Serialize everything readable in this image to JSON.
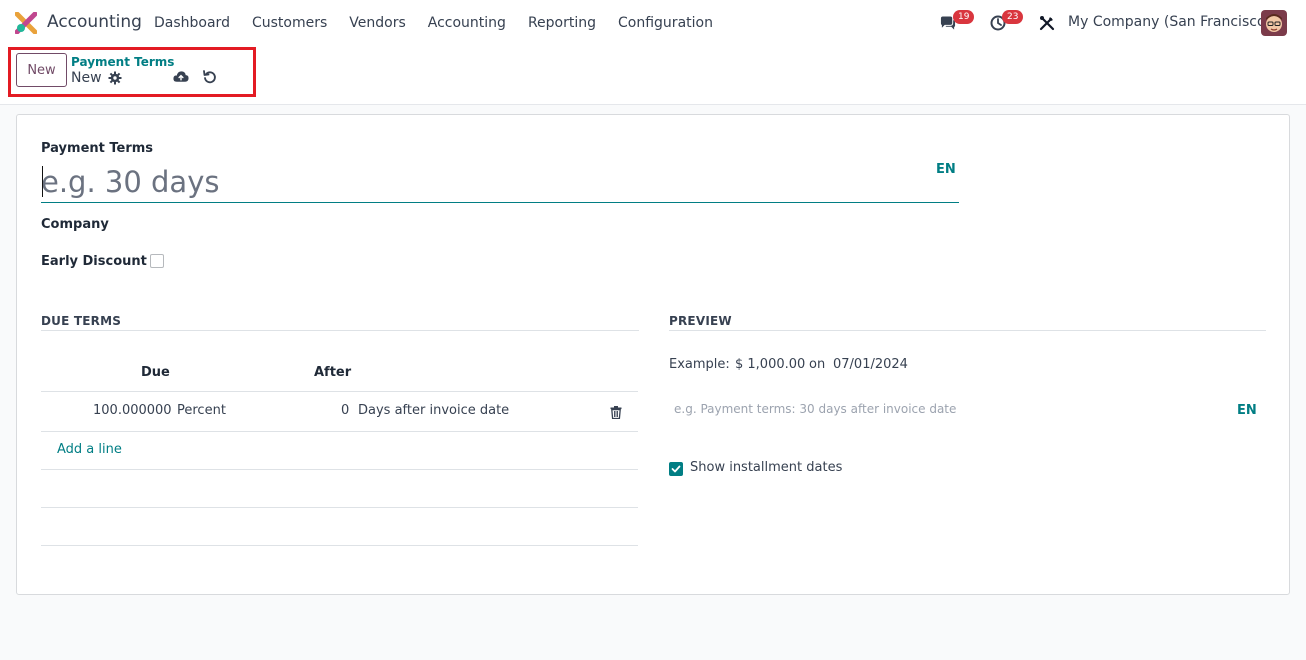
{
  "navbar": {
    "app_name": "Accounting",
    "menu": [
      "Dashboard",
      "Customers",
      "Vendors",
      "Accounting",
      "Reporting",
      "Configuration"
    ],
    "messages_count": "19",
    "activities_count": "23",
    "company": "My Company (San Francisco)"
  },
  "control_panel": {
    "new_label": "New",
    "breadcrumb_parent": "Payment Terms",
    "breadcrumb_current": "New"
  },
  "form": {
    "name_label": "Payment Terms",
    "name_placeholder": "e.g. 30 days",
    "lang_badge": "EN",
    "company_label": "Company",
    "early_discount_label": "Early Discount",
    "early_discount_checked": false
  },
  "due_terms": {
    "title": "DUE TERMS",
    "columns": [
      "Due",
      "After"
    ],
    "rows": [
      {
        "value": "100.000000",
        "value_type": "Percent",
        "days": "0",
        "delay_type": "Days after invoice date"
      }
    ],
    "add_line_label": "Add a line"
  },
  "preview": {
    "title": "PREVIEW",
    "example_label": "Example:",
    "amount": "$ 1,000.00",
    "on_label": "on",
    "date": "07/01/2024",
    "note_placeholder": "e.g. Payment terms: 30 days after invoice date",
    "note_lang": "EN",
    "show_installment_label": "Show installment dates",
    "show_installment_checked": true
  },
  "colors": {
    "accent": "#017e84",
    "brand": "#714b67",
    "badge": "#d9363e",
    "highlight": "#e31b23"
  }
}
